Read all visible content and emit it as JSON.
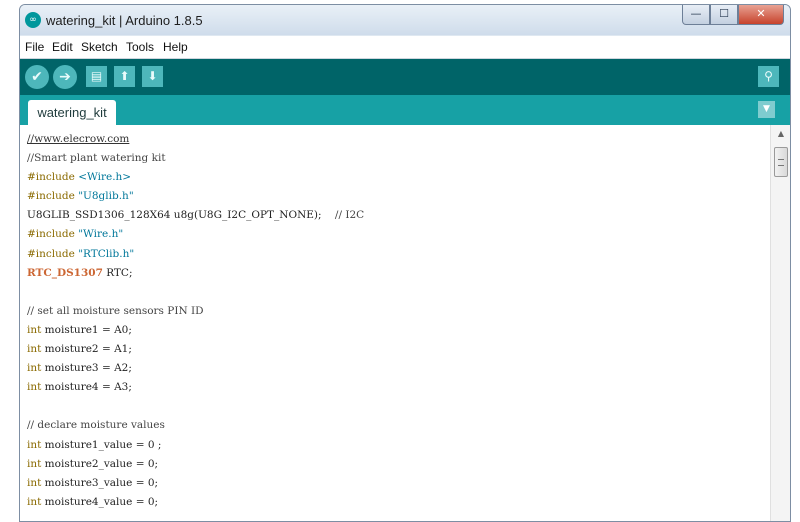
{
  "window": {
    "title": "watering_kit | Arduino 1.8.5",
    "app_icon": "∞",
    "controls": {
      "minimize": "—",
      "maximize": "☐",
      "close": "✕"
    }
  },
  "menu": [
    "File",
    "Edit",
    "Sketch",
    "Tools",
    "Help"
  ],
  "toolbar": {
    "verify_icon": "✔",
    "upload_icon": "➔",
    "new_icon": "▤",
    "open_icon": "⬆",
    "save_icon": "⬇",
    "serial_icon": "⚲"
  },
  "tabs": {
    "active": "watering_kit",
    "menu_icon": "▼"
  },
  "code": {
    "l1": "//www.elecrow.com",
    "l2": "//Smart plant watering kit",
    "l3_kw": "#include ",
    "l3_str": "<Wire.h>",
    "l4_kw": "#include ",
    "l4_str": "\"U8glib.h\"",
    "l5_code": "U8GLIB_SSD1306_128X64 u8g(U8G_I2C_OPT_NONE);",
    "l5_comment": "    // I2C",
    "l6_kw": "#include ",
    "l6_str": "\"Wire.h\"",
    "l7_kw": "#include ",
    "l7_str": "\"RTClib.h\"",
    "l8_type": "RTC_DS1307",
    "l8_rest": " RTC;",
    "l10": "// set all moisture sensors PIN ID",
    "l11_kw": "int",
    "l11_rest": " moisture1 = A0;",
    "l12_kw": "int",
    "l12_rest": " moisture2 = A1;",
    "l13_kw": "int",
    "l13_rest": " moisture3 = A2;",
    "l14_kw": "int",
    "l14_rest": " moisture4 = A3;",
    "l16": "// declare moisture values",
    "l17_kw": "int",
    "l17_rest": " moisture1_value = 0 ;",
    "l18_kw": "int",
    "l18_rest": " moisture2_value = 0;",
    "l19_kw": "int",
    "l19_rest": " moisture3_value = 0;",
    "l20_kw": "int",
    "l20_rest": " moisture4_value = 0;"
  },
  "scrollbar": {
    "up_icon": "▲"
  },
  "colors": {
    "toolbar": "#006468",
    "tab_bar": "#17a1a5",
    "button": "#4db7bb",
    "comment": "#444444",
    "keyword": "#8a6a00",
    "string": "#00779a",
    "type": "#cc6633"
  }
}
